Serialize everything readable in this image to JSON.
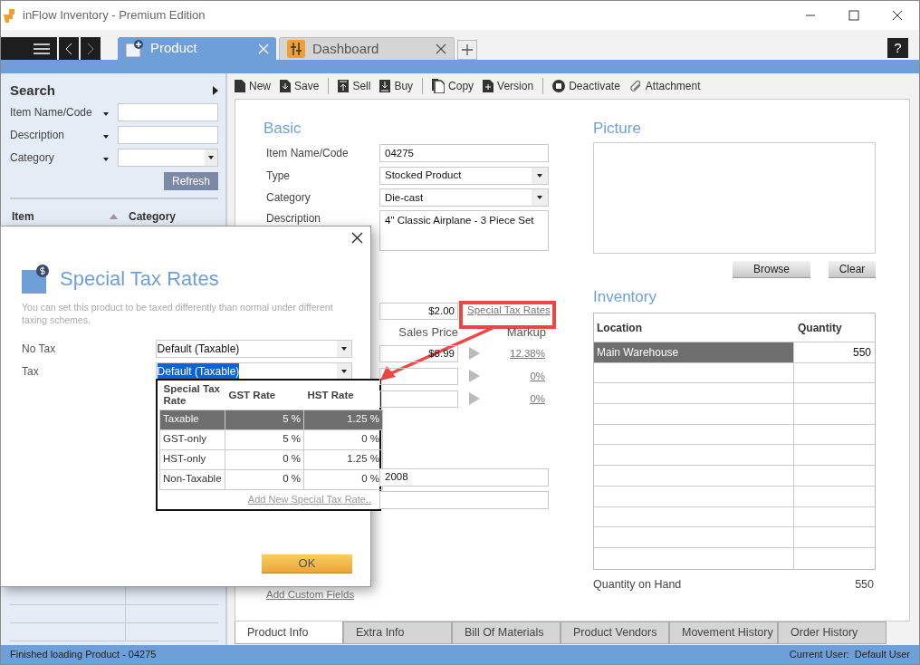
{
  "window": {
    "title": "inFlow Inventory - Premium Edition"
  },
  "tabs": [
    {
      "label": "Product",
      "selected": true
    },
    {
      "label": "Dashboard",
      "selected": false
    }
  ],
  "help_button": "?",
  "sidebar": {
    "title": "Search",
    "filters": [
      {
        "label": "Item Name/Code",
        "kind": "text"
      },
      {
        "label": "Description",
        "kind": "text"
      },
      {
        "label": "Category",
        "kind": "select"
      }
    ],
    "refresh": "Refresh",
    "columns": [
      "Item",
      "Category"
    ]
  },
  "toolbar": [
    {
      "label": "New",
      "divider_before": false
    },
    {
      "label": "Save",
      "divider_before": false
    },
    {
      "label": "Sell",
      "divider_before": true
    },
    {
      "label": "Buy",
      "divider_before": false
    },
    {
      "label": "Copy",
      "divider_before": true
    },
    {
      "label": "Version",
      "divider_before": false
    },
    {
      "label": "Deactivate",
      "divider_before": true
    },
    {
      "label": "Attachment",
      "divider_before": false
    }
  ],
  "basic": {
    "title": "Basic",
    "fields": [
      {
        "label": "Item Name/Code",
        "value": "04275",
        "kind": "text"
      },
      {
        "label": "Type",
        "value": "Stocked Product",
        "kind": "select"
      },
      {
        "label": "Category",
        "value": "Die-cast",
        "kind": "select"
      },
      {
        "label": "Description",
        "value": "4\" Classic Airplane - 3 Piece Set",
        "kind": "textarea"
      }
    ]
  },
  "pricing": {
    "cost": "$2.00",
    "special_tax_link": {
      "label": "Special Tax Rates",
      "highlighted": true
    },
    "columns": [
      "Sales Price",
      "Markup"
    ],
    "rows": [
      {
        "price": "$8.99",
        "markup": "12.38%"
      },
      {
        "price": "",
        "markup": "0%"
      },
      {
        "price": "",
        "markup": "0%"
      }
    ]
  },
  "extra_fields": [
    {
      "value": "2008",
      "kind": "text"
    },
    {
      "kind": "text"
    }
  ],
  "add_custom_fields": "Add Custom Fields",
  "picture": {
    "title": "Picture",
    "buttons": [
      "Browse",
      "Clear"
    ]
  },
  "inventory": {
    "title": "Inventory",
    "columns": [
      "Location",
      "Quantity"
    ],
    "rows": [
      {
        "location": "Main Warehouse",
        "quantity": "550",
        "selected": true
      }
    ],
    "total_label": "Quantity on Hand",
    "total": "550"
  },
  "bottom_tabs": [
    {
      "label": "Product Info",
      "selected": true
    },
    {
      "label": "Extra Info",
      "selected": false
    },
    {
      "label": "Bill Of Materials",
      "selected": false
    },
    {
      "label": "Product Vendors",
      "selected": false
    },
    {
      "label": "Movement History",
      "selected": false
    },
    {
      "label": "Order History",
      "selected": false
    }
  ],
  "status_bar": {
    "message": "Finished loading Product - 04275",
    "user_label": "Current User:",
    "user": "Default User"
  },
  "dialog": {
    "title": "Special Tax Rates",
    "description": "You can set this product to be taxed differently than normal under different taxing schemes.",
    "fields": [
      {
        "label": "No Tax",
        "value": "Default (Taxable)",
        "text_selected": false
      },
      {
        "label": "Tax",
        "value": "Default (Taxable)",
        "text_selected": true
      }
    ],
    "rate_list": {
      "columns": [
        "Special Tax Rate",
        "GST Rate",
        "HST Rate"
      ],
      "rows": [
        {
          "name": "Taxable",
          "gst": "5 %",
          "hst": "1.25 %",
          "selected": true
        },
        {
          "name": "GST-only",
          "gst": "5 %",
          "hst": "0 %",
          "selected": false
        },
        {
          "name": "HST-only",
          "gst": "0 %",
          "hst": "1.25 %",
          "selected": false
        },
        {
          "name": "Non-Taxable",
          "gst": "0 %",
          "hst": "0 %",
          "selected": false
        }
      ],
      "add_link": "Add New Special Tax Rate.."
    },
    "ok": "OK"
  }
}
